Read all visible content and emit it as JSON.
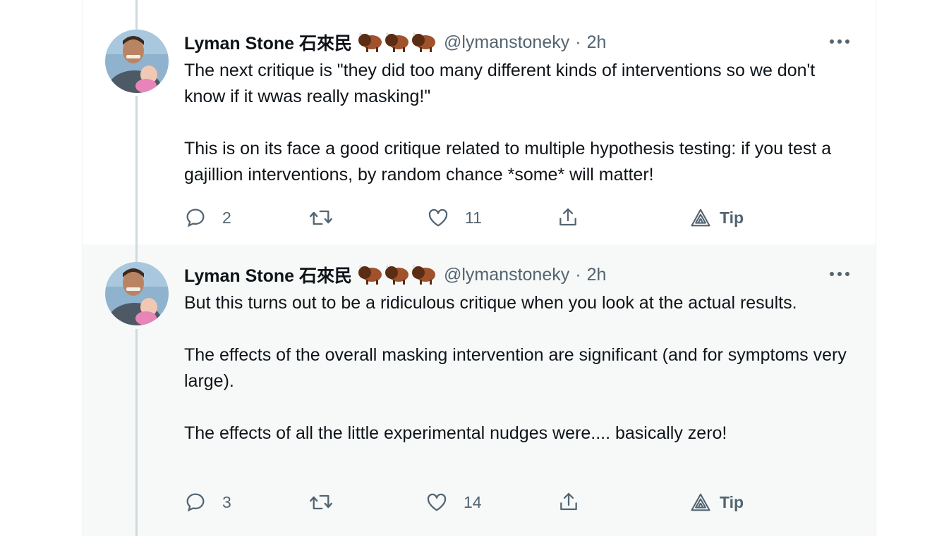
{
  "colors": {
    "text": "#0f1419",
    "secondary": "#536471",
    "thread_line": "#cfd9de",
    "hover_background": "#f7f9f9"
  },
  "tweets": [
    {
      "author_name": "Lyman Stone 石來民",
      "author_emoji": [
        "bison",
        "bison",
        "bison"
      ],
      "handle": "@lymanstoneky",
      "separator": "·",
      "time": "2h",
      "text": "The next critique is \"they did too many different kinds of interventions so we don't know if it wwas really masking!\"\n\nThis is on its face a good critique related to multiple hypothesis testing: if you test a gajillion interventions, by random chance *some* will matter!",
      "replies": "2",
      "retweets": "",
      "likes": "11",
      "tip_label": "Tip"
    },
    {
      "author_name": "Lyman Stone 石來民",
      "author_emoji": [
        "bison",
        "bison",
        "bison"
      ],
      "handle": "@lymanstoneky",
      "separator": "·",
      "time": "2h",
      "text": "But this turns out to be a ridiculous critique when you look at the actual results.\n\nThe effects of the overall masking intervention are significant (and for symptoms very large).\n\nThe effects of all the little experimental nudges were.... basically zero!",
      "replies": "3",
      "retweets": "",
      "likes": "14",
      "tip_label": "Tip"
    }
  ]
}
